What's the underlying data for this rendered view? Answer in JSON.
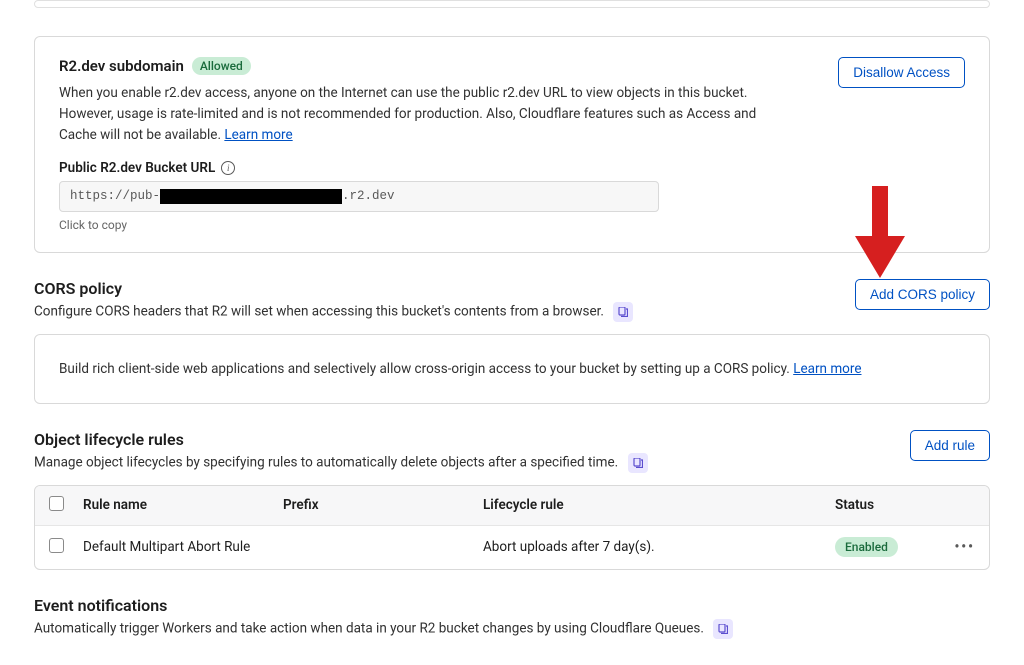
{
  "r2dev": {
    "title": "R2.dev subdomain",
    "badge": "Allowed",
    "description_prefix": "When you enable r2.dev access, anyone on the Internet can use the public r2.dev URL to view objects in this bucket. However, usage is rate-limited and is not recommended for production. Also, Cloudflare features such as Access and Cache will not be available. ",
    "learn_more": "Learn more",
    "url_label": "Public R2.dev Bucket URL",
    "url_prefix": "https://pub-",
    "url_suffix": ".r2.dev",
    "click_to_copy": "Click to copy",
    "disallow_button": "Disallow Access"
  },
  "cors": {
    "title": "CORS policy",
    "description": "Configure CORS headers that R2 will set when accessing this bucket's contents from a browser.",
    "add_button": "Add CORS policy",
    "info_prefix": "Build rich client-side web applications and selectively allow cross-origin access to your bucket by setting up a CORS policy. ",
    "learn_more": "Learn more"
  },
  "lifecycle": {
    "title": "Object lifecycle rules",
    "description": "Manage object lifecycles by specifying rules to automatically delete objects after a specified time.",
    "add_button": "Add rule",
    "headers": {
      "name": "Rule name",
      "prefix": "Prefix",
      "rule": "Lifecycle rule",
      "status": "Status"
    },
    "rows": [
      {
        "name": "Default Multipart Abort Rule",
        "prefix": "",
        "rule": "Abort uploads after 7 day(s).",
        "status": "Enabled"
      }
    ]
  },
  "events": {
    "title": "Event notifications",
    "description": "Automatically trigger Workers and take action when data in your R2 bucket changes by using Cloudflare Queues."
  }
}
